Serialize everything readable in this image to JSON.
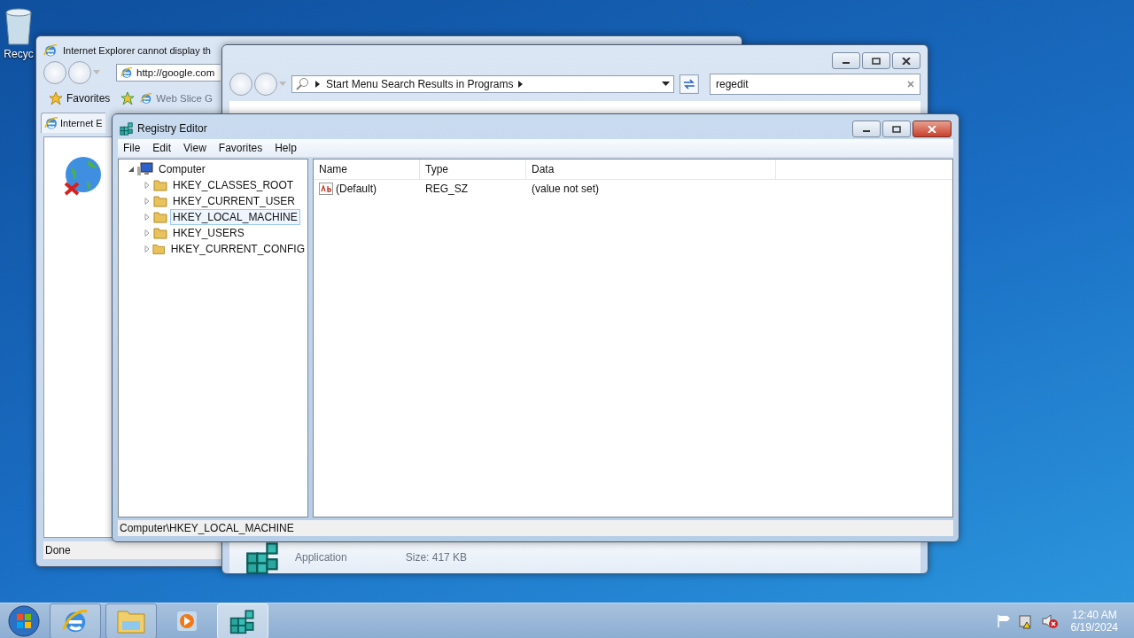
{
  "desktop": {
    "icons": [
      {
        "label": "Recyc"
      }
    ]
  },
  "ie_window": {
    "title": "Internet Explorer cannot display th",
    "address": "http://google.com",
    "favorites": "Favorites",
    "favorites_items": [
      "Web Slice G"
    ],
    "tab": "Internet E",
    "status": "Done"
  },
  "explorer_window": {
    "address": "Start Menu Search Results in Programs",
    "search": {
      "value": "regedit"
    },
    "details": {
      "type": "Application",
      "size": "Size: 417 KB"
    }
  },
  "regedit_window": {
    "title": "Registry Editor",
    "menu": [
      "File",
      "Edit",
      "View",
      "Favorites",
      "Help"
    ],
    "tree": {
      "label": "Computer",
      "expanded": true,
      "children": [
        {
          "label": "HKEY_CLASSES_ROOT",
          "expanded": false,
          "selected": false
        },
        {
          "label": "HKEY_CURRENT_USER",
          "expanded": false,
          "selected": false
        },
        {
          "label": "HKEY_LOCAL_MACHINE",
          "expanded": false,
          "selected": true
        },
        {
          "label": "HKEY_USERS",
          "expanded": false,
          "selected": false
        },
        {
          "label": "HKEY_CURRENT_CONFIG",
          "expanded": false,
          "selected": false
        }
      ]
    },
    "columns": [
      "Name",
      "Type",
      "Data"
    ],
    "rows": [
      {
        "name": "(Default)",
        "type": "REG_SZ",
        "data": "(value not set)"
      }
    ],
    "status_bar": "Computer\\HKEY_LOCAL_MACHINE"
  },
  "taskbar": {
    "apps": [
      {
        "kind": "browser",
        "running": true,
        "selected": false
      },
      {
        "kind": "folder",
        "running": true,
        "selected": false
      },
      {
        "kind": "media",
        "running": false,
        "selected": false
      },
      {
        "kind": "registry",
        "running": true,
        "selected": true
      }
    ],
    "clock": {
      "time": "12:40 AM",
      "date": "6/19/2024"
    }
  }
}
